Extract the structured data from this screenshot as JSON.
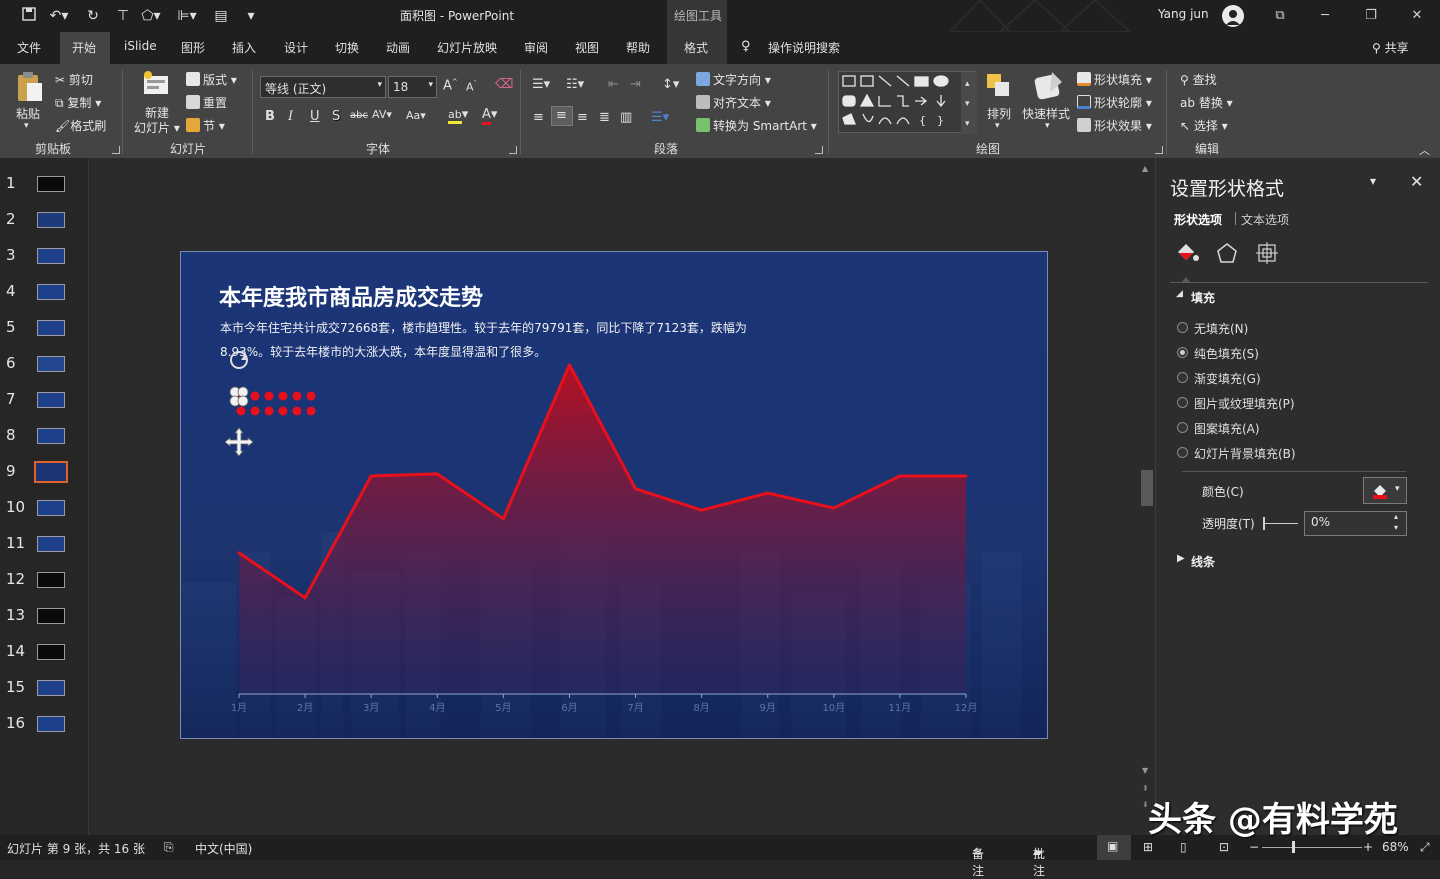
{
  "titlebar": {
    "doc_title": "面积图  -  PowerPoint",
    "context_tools": "绘图工具",
    "user": "Yang jun"
  },
  "tabs": [
    "文件",
    "开始",
    "iSlide",
    "图形",
    "插入",
    "设计",
    "切换",
    "动画",
    "幻灯片放映",
    "审阅",
    "视图",
    "帮助",
    "格式"
  ],
  "active_tab": "开始",
  "tell_me": "操作说明搜索",
  "share": "共享",
  "ribbon": {
    "clipboard": {
      "paste": "粘贴",
      "cut": "剪切",
      "copy": "复制",
      "format_painter": "格式刷",
      "label": "剪贴板"
    },
    "slides": {
      "new_slide": "新建",
      "new_slide2": "幻灯片",
      "layout": "版式",
      "reset": "重置",
      "section": "节",
      "label": "幻灯片"
    },
    "font": {
      "font_name": "等线 (正文)",
      "font_size": "18",
      "label": "字体"
    },
    "paragraph": {
      "text_direction": "文字方向",
      "align_text": "对齐文本",
      "smartart": "转换为 SmartArt",
      "label": "段落"
    },
    "drawing": {
      "arrange": "排列",
      "quick_styles": "快速样式",
      "shape_fill": "形状填充",
      "shape_outline": "形状轮廓",
      "shape_effects": "形状效果",
      "label": "绘图"
    },
    "editing": {
      "find": "查找",
      "replace": "替换",
      "select": "选择",
      "label": "编辑"
    }
  },
  "thumbnails": [
    "1",
    "2",
    "3",
    "4",
    "5",
    "6",
    "7",
    "8",
    "9",
    "10",
    "11",
    "12",
    "13",
    "14",
    "15",
    "16"
  ],
  "selected_slide": 9,
  "slide": {
    "title": "本年度我市商品房成交走势",
    "body_line1": "本市今年住宅共计成交72668套，楼市趋理性。较于去年的79791套，同比下降了7123套，跌幅为",
    "body_line2": "8.93%。较于去年楼市的大涨大跌，本年度显得温和了很多。"
  },
  "chart_data": {
    "type": "area",
    "categories": [
      "1月",
      "2月",
      "3月",
      "4月",
      "5月",
      "6月",
      "7月",
      "8月",
      "9月",
      "10月",
      "11月",
      "12月"
    ],
    "values": [
      6.6,
      4.5,
      10.2,
      10.3,
      8.2,
      15.4,
      9.6,
      8.6,
      9.4,
      8.7,
      10.2,
      10.2
    ],
    "ylim": [
      0,
      16
    ],
    "title": "",
    "xlabel": "",
    "ylabel": "",
    "colors": {
      "line": "#e8101a",
      "fill_top": "#c40d1b",
      "fill_bottom": "#3a1e55"
    }
  },
  "pane": {
    "title": "设置形状格式",
    "tab_shape": "形状选项",
    "tab_text": "文本选项",
    "fill_header": "填充",
    "options": [
      "无填充(N)",
      "纯色填充(S)",
      "渐变填充(G)",
      "图片或纹理填充(P)",
      "图案填充(A)",
      "幻灯片背景填充(B)"
    ],
    "selected_option": 1,
    "color_label": "颜色(C)",
    "transparency_label": "透明度(T)",
    "transparency_value": "0%",
    "line_header": "线条"
  },
  "status": {
    "slide_info": "幻灯片 第 9 张，共 16 张",
    "language": "中文(中国)",
    "notes": "备注",
    "comments": "批注",
    "zoom": "68%"
  },
  "watermark": "头条 @有料学苑"
}
